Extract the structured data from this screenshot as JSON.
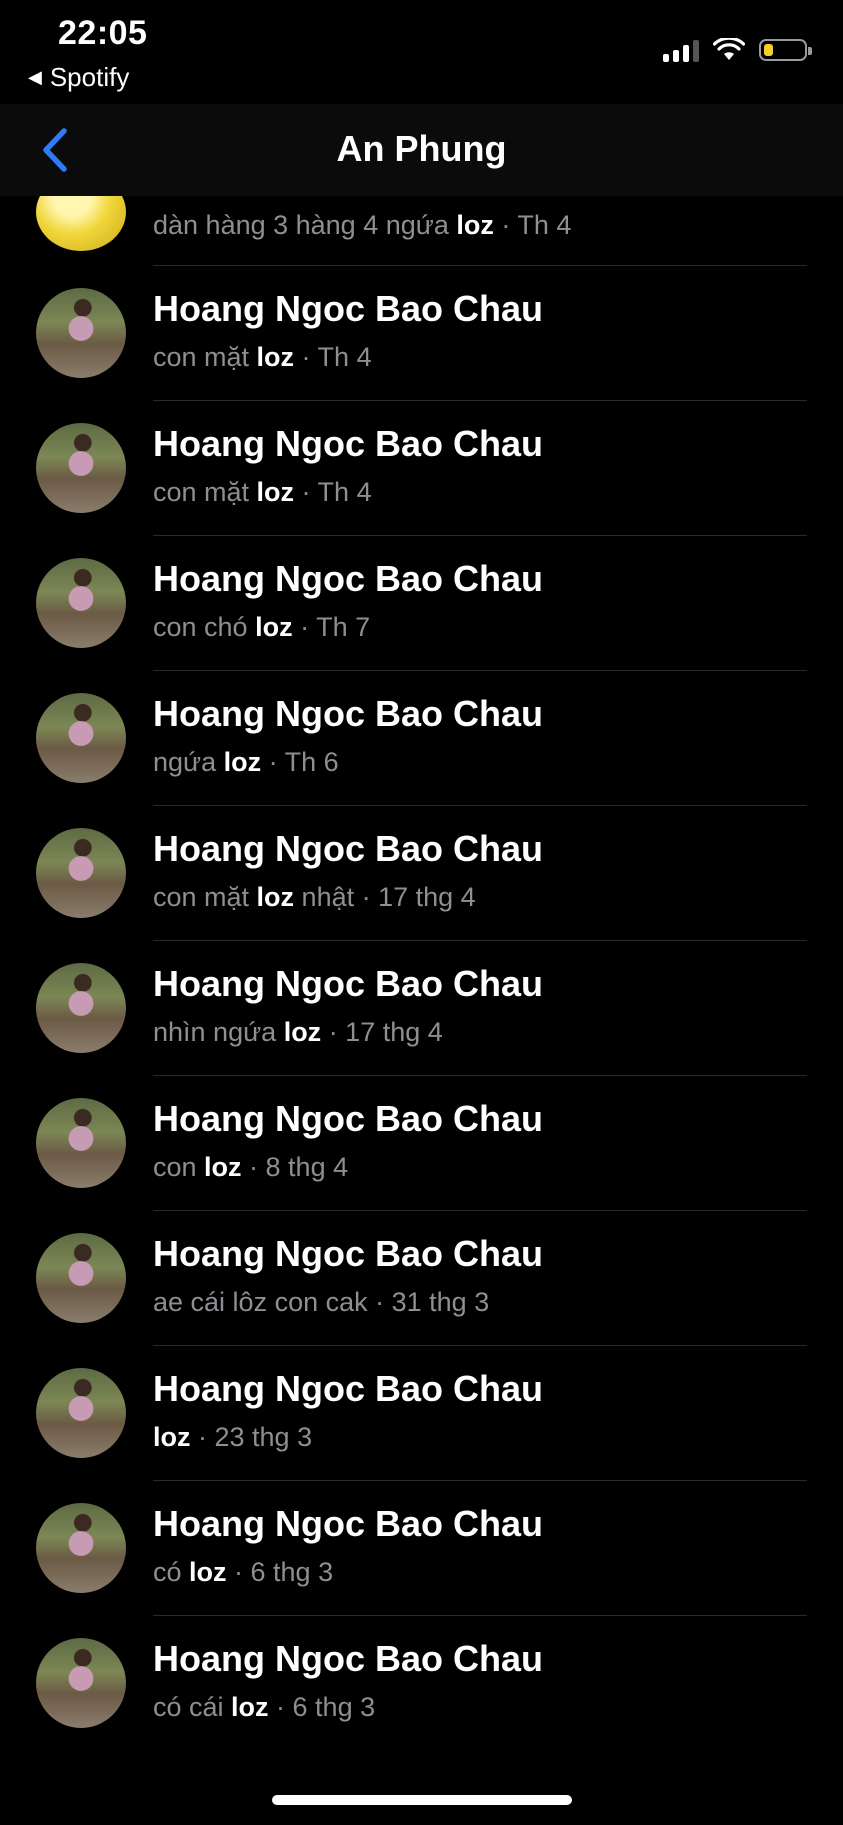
{
  "status_bar": {
    "time": "22:05",
    "back_app": "Spotify"
  },
  "header": {
    "title": "An Phung"
  },
  "results": [
    {
      "name": "",
      "pre": "dàn hàng 3 hàng 4 ngứa ",
      "hl": "loz",
      "post": "",
      "date": " · Th 4"
    },
    {
      "name": "Hoang Ngoc Bao Chau",
      "pre": "con mặt ",
      "hl": "loz",
      "post": "",
      "date": " · Th 4"
    },
    {
      "name": "Hoang Ngoc Bao Chau",
      "pre": "con mặt ",
      "hl": "loz",
      "post": "",
      "date": " · Th 4"
    },
    {
      "name": "Hoang Ngoc Bao Chau",
      "pre": "con chó ",
      "hl": "loz",
      "post": "",
      "date": " · Th 7"
    },
    {
      "name": "Hoang Ngoc Bao Chau",
      "pre": "ngứa ",
      "hl": "loz",
      "post": "",
      "date": " · Th 6"
    },
    {
      "name": "Hoang Ngoc Bao Chau",
      "pre": "con mặt ",
      "hl": "loz",
      "post": " nhật",
      "date": " · 17 thg 4"
    },
    {
      "name": "Hoang Ngoc Bao Chau",
      "pre": "nhìn ngứa ",
      "hl": "loz",
      "post": "",
      "date": " · 17 thg 4"
    },
    {
      "name": "Hoang Ngoc Bao Chau",
      "pre": "con ",
      "hl": "loz",
      "post": "",
      "date": " · 8 thg 4"
    },
    {
      "name": "Hoang Ngoc Bao Chau",
      "pre": "ae cái lôz con cak",
      "hl": "",
      "post": "",
      "date": " · 31 thg 3"
    },
    {
      "name": "Hoang Ngoc Bao Chau",
      "pre": "",
      "hl": "loz",
      "post": "",
      "date": " · 23 thg 3"
    },
    {
      "name": "Hoang Ngoc Bao Chau",
      "pre": "có ",
      "hl": "loz",
      "post": "",
      "date": " · 6 thg 3"
    },
    {
      "name": "Hoang Ngoc Bao Chau",
      "pre": "có cái ",
      "hl": "loz",
      "post": "",
      "date": " · 6 thg 3"
    }
  ]
}
